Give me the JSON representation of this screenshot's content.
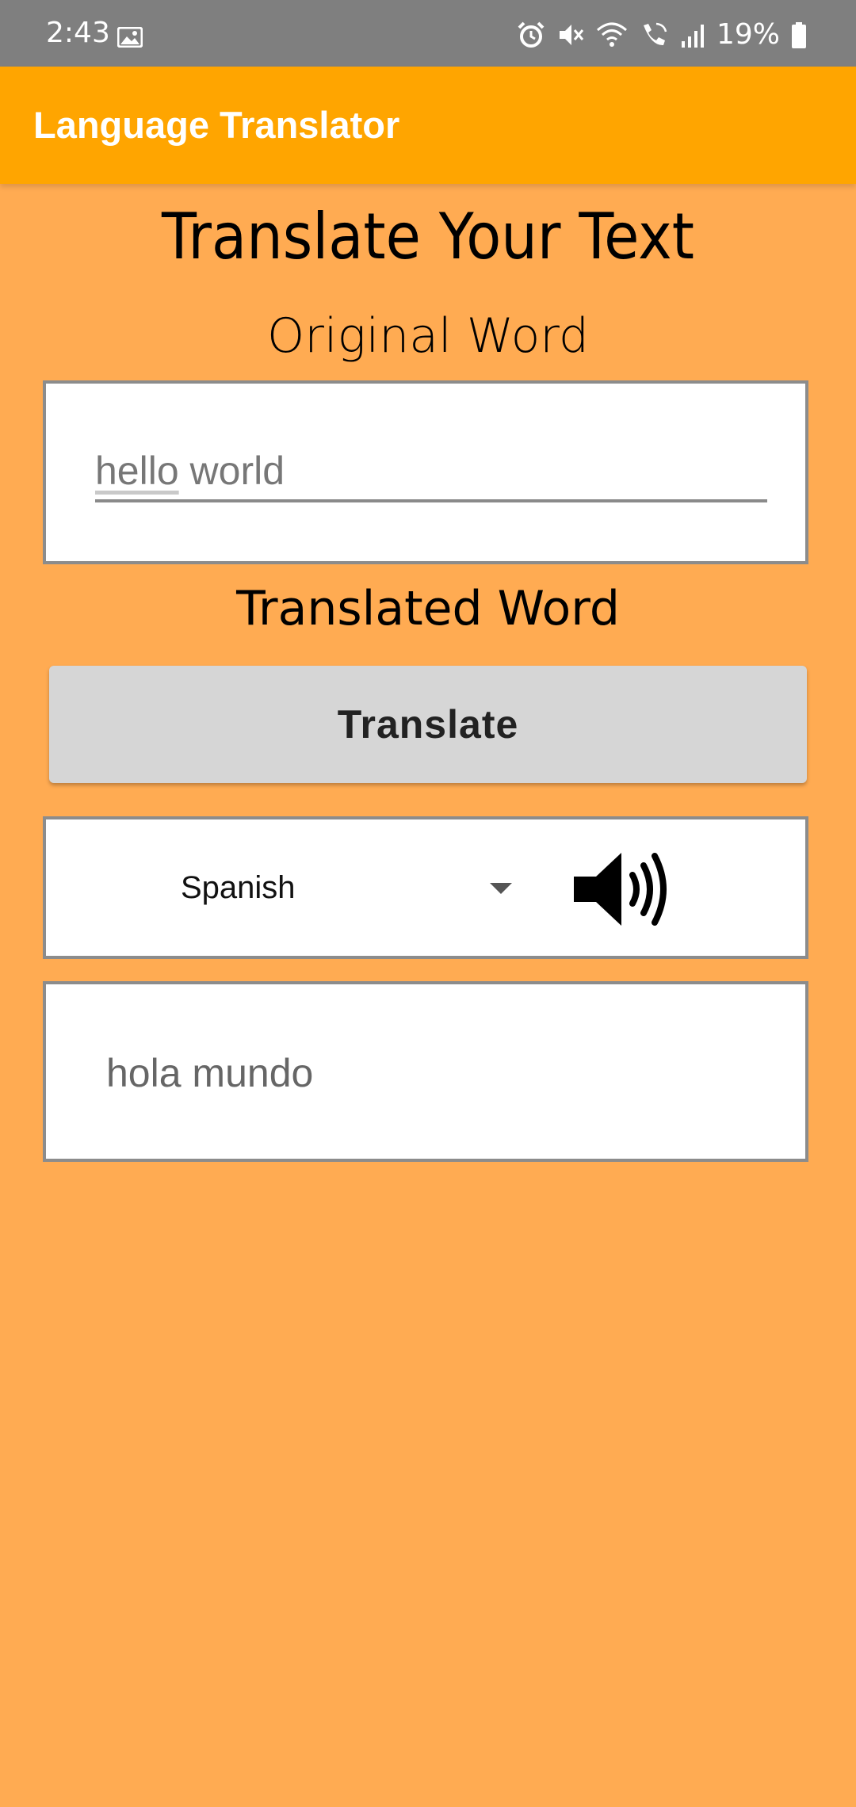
{
  "status_bar": {
    "time": "2:43",
    "battery": "19%",
    "icons": [
      "gallery-icon",
      "alarm-icon",
      "mute-icon",
      "wifi-icon",
      "wifi-calling-icon",
      "signal-icon",
      "battery-icon"
    ]
  },
  "app_bar": {
    "title": "Language Translator"
  },
  "main": {
    "heading": "Translate Your Text",
    "original_label": "Original Word",
    "input": {
      "word1": "hello",
      "word2": " world"
    },
    "translated_label": "Translated Word",
    "translate_button": "Translate",
    "language": {
      "selected": "Spanish"
    },
    "speaker_icon": "speaker-icon",
    "output": "hola mundo"
  },
  "colors": {
    "background": "#FFAB52",
    "app_bar": "#FFA500",
    "status_bar": "#7F7F7F",
    "button": "#D6D6D6"
  }
}
